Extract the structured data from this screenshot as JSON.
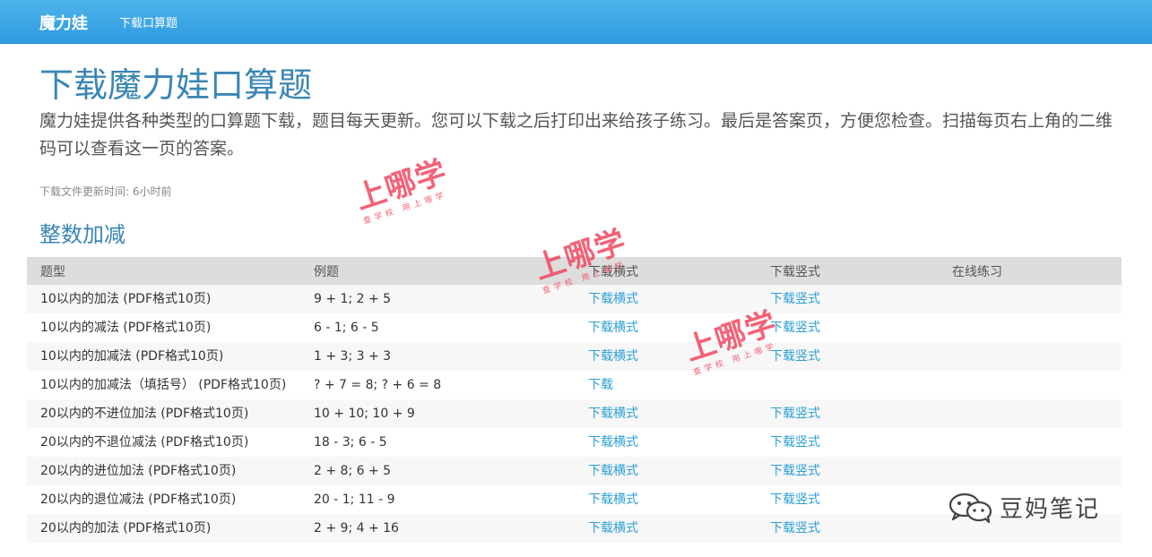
{
  "nav": {
    "brand": "魔力娃",
    "link": "下载口算题"
  },
  "page": {
    "title": "下载魔力娃口算题",
    "lead": "魔力娃提供各种类型的口算题下载，题目每天更新。您可以下载之后打印出来给孩子练习。最后是答案页，方便您检查。扫描每页右上角的二维码可以查看这一页的答案。",
    "update_time": "下载文件更新时间: 6小时前"
  },
  "section": {
    "title": "整数加减",
    "table": {
      "headers": [
        "题型",
        "例题",
        "下载横式",
        "下载竖式",
        "在线练习"
      ],
      "rows": [
        {
          "type": "10以内的加法 (PDF格式10页)",
          "example": "9 + 1; 2 + 5",
          "horizontal": "下载横式",
          "vertical": "下载竖式",
          "online": ""
        },
        {
          "type": "10以内的减法 (PDF格式10页)",
          "example": "6 - 1; 6 - 5",
          "horizontal": "下载横式",
          "vertical": "下载竖式",
          "online": ""
        },
        {
          "type": "10以内的加减法 (PDF格式10页)",
          "example": "1 + 3; 3 + 3",
          "horizontal": "下载横式",
          "vertical": "下载竖式",
          "online": ""
        },
        {
          "type": "10以内的加减法（填括号） (PDF格式10页)",
          "example": "? + 7 = 8; ? + 6 = 8",
          "horizontal": "下载",
          "vertical": "",
          "online": ""
        },
        {
          "type": "20以内的不进位加法 (PDF格式10页)",
          "example": "10 + 10; 10 + 9",
          "horizontal": "下载横式",
          "vertical": "下载竖式",
          "online": ""
        },
        {
          "type": "20以内的不退位减法 (PDF格式10页)",
          "example": "18 - 3; 6 - 5",
          "horizontal": "下载横式",
          "vertical": "下载竖式",
          "online": ""
        },
        {
          "type": "20以内的进位加法 (PDF格式10页)",
          "example": "2 + 8; 6 + 5",
          "horizontal": "下载横式",
          "vertical": "下载竖式",
          "online": ""
        },
        {
          "type": "20以内的退位减法 (PDF格式10页)",
          "example": "20 - 1; 11 - 9",
          "horizontal": "下载横式",
          "vertical": "下载竖式",
          "online": ""
        },
        {
          "type": "20以内的加法 (PDF格式10页)",
          "example": "2 + 9; 4 + 16",
          "horizontal": "下载横式",
          "vertical": "下载竖式",
          "online": ""
        }
      ]
    }
  },
  "watermark": {
    "big": "上哪学",
    "small": "查学校 用上哪学",
    "color": "#f2465f"
  },
  "footer": {
    "wechat_icon": "wechat-icon",
    "account": "豆妈笔记"
  }
}
